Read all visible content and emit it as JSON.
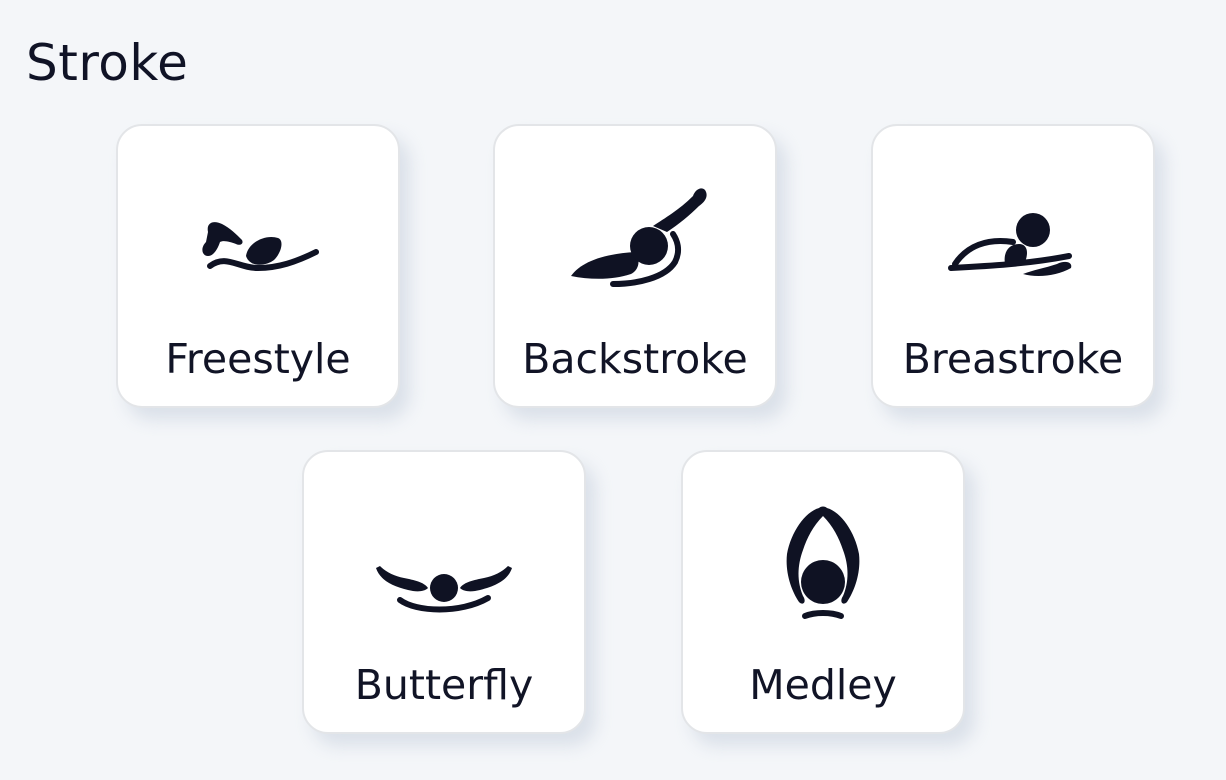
{
  "section": {
    "title": "Stroke"
  },
  "strokes": [
    {
      "label": "Freestyle",
      "icon": "freestyle-swimmer-icon"
    },
    {
      "label": "Backstroke",
      "icon": "backstroke-swimmer-icon"
    },
    {
      "label": "Breastroke",
      "icon": "breaststroke-swimmer-icon"
    },
    {
      "label": "Butterfly",
      "icon": "butterfly-swimmer-icon"
    },
    {
      "label": "Medley",
      "icon": "medley-swimmer-icon"
    }
  ],
  "colors": {
    "background": "#f4f6f9",
    "card": "#ffffff",
    "card_border": "#e3e5e8",
    "icon": "#0f1223",
    "text": "#111426"
  }
}
